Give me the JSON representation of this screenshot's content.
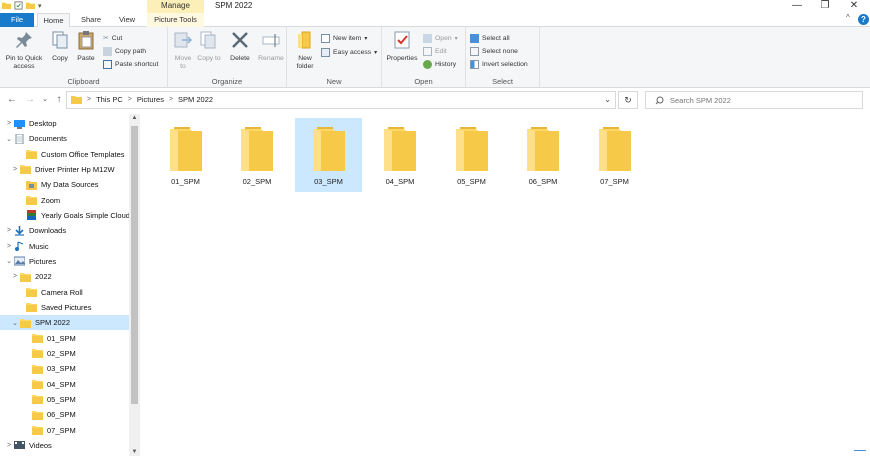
{
  "window": {
    "title": "SPM 2022",
    "context_tab": "Manage",
    "controls": {
      "minimize": "—",
      "maximize": "❐",
      "close": "✕",
      "collapse": "^",
      "help": "?"
    }
  },
  "tabs": [
    {
      "label": "File"
    },
    {
      "label": "Home"
    },
    {
      "label": "Share"
    },
    {
      "label": "View"
    },
    {
      "label": "Picture Tools"
    }
  ],
  "ribbon": {
    "clipboard": {
      "label": "Clipboard",
      "pin": "Pin to Quick access",
      "copy": "Copy",
      "paste": "Paste",
      "cut": "Cut",
      "copy_path": "Copy path",
      "paste_shortcut": "Paste shortcut"
    },
    "organize": {
      "label": "Organize",
      "move_to": "Move to",
      "copy_to": "Copy to",
      "delete": "Delete",
      "rename": "Rename"
    },
    "new": {
      "label": "New",
      "new_folder": "New folder",
      "new_item": "New item",
      "easy_access": "Easy access"
    },
    "open": {
      "label": "Open",
      "properties": "Properties",
      "open": "Open",
      "edit": "Edit",
      "history": "History"
    },
    "select": {
      "label": "Select",
      "select_all": "Select all",
      "select_none": "Select none",
      "invert": "Invert selection"
    }
  },
  "address": {
    "crumbs": [
      "This PC",
      "Pictures",
      "SPM 2022"
    ],
    "sep": ">",
    "search_placeholder": "Search SPM 2022"
  },
  "nav": {
    "back": "←",
    "forward": "→",
    "recent": "⌄",
    "up": "↑",
    "refresh": "↻",
    "dropdown": "⌄"
  },
  "tree": [
    {
      "label": "Desktop",
      "chev": ">",
      "icon": "desktop"
    },
    {
      "label": "Documents",
      "chev": "⌄",
      "icon": "documents"
    },
    {
      "label": "Custom Office Templates",
      "chev": "",
      "icon": "folder"
    },
    {
      "label": "Driver Printer Hp M12W",
      "chev": ">",
      "icon": "folder"
    },
    {
      "label": "My Data Sources",
      "chev": "",
      "icon": "datasource"
    },
    {
      "label": "Zoom",
      "chev": "",
      "icon": "folder"
    },
    {
      "label": "Yearly Goals Simple Cloud I",
      "chev": "",
      "icon": "archive"
    },
    {
      "label": "Downloads",
      "chev": ">",
      "icon": "downloads"
    },
    {
      "label": "Music",
      "chev": ">",
      "icon": "music"
    },
    {
      "label": "Pictures",
      "chev": "⌄",
      "icon": "pictures"
    },
    {
      "label": "2022",
      "chev": ">",
      "icon": "folder"
    },
    {
      "label": "Camera Roll",
      "chev": "",
      "icon": "folder"
    },
    {
      "label": "Saved Pictures",
      "chev": "",
      "icon": "folder"
    },
    {
      "label": "SPM 2022",
      "chev": "⌄",
      "icon": "folder"
    },
    {
      "label": "01_SPM",
      "chev": "",
      "icon": "folder"
    },
    {
      "label": "02_SPM",
      "chev": "",
      "icon": "folder"
    },
    {
      "label": "03_SPM",
      "chev": "",
      "icon": "folder"
    },
    {
      "label": "04_SPM",
      "chev": "",
      "icon": "folder"
    },
    {
      "label": "05_SPM",
      "chev": "",
      "icon": "folder"
    },
    {
      "label": "06_SPM",
      "chev": "",
      "icon": "folder"
    },
    {
      "label": "07_SPM",
      "chev": "",
      "icon": "folder"
    },
    {
      "label": "Videos",
      "chev": ">",
      "icon": "videos"
    }
  ],
  "scroll": {
    "up": "▲",
    "down": "▼"
  },
  "files": [
    {
      "name": "01_SPM"
    },
    {
      "name": "02_SPM"
    },
    {
      "name": "03_SPM"
    },
    {
      "name": "04_SPM"
    },
    {
      "name": "05_SPM"
    },
    {
      "name": "06_SPM"
    },
    {
      "name": "07_SPM"
    }
  ],
  "colors": {
    "accent": "#1979ca",
    "selection": "#cce8ff",
    "folder": "#ffd866",
    "manage_tab": "#fcf0b8"
  }
}
